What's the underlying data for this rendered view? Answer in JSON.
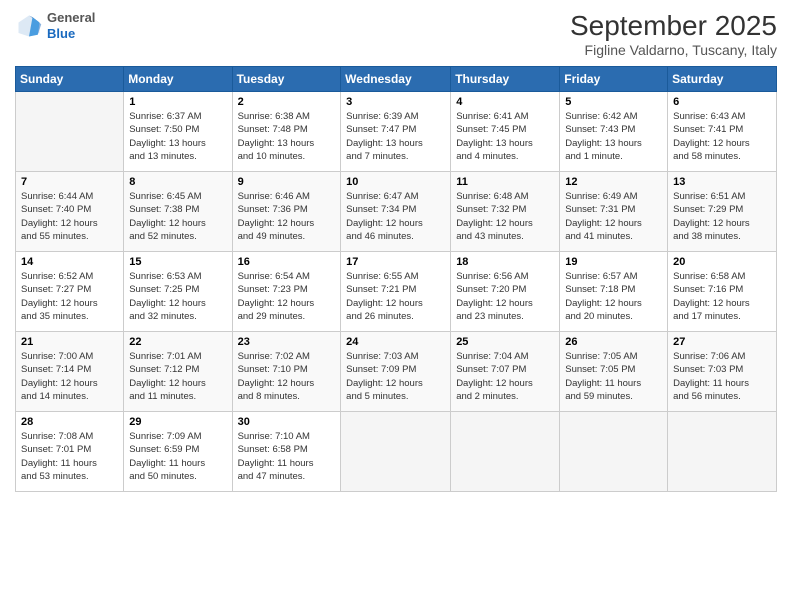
{
  "header": {
    "logo": {
      "general": "General",
      "blue": "Blue"
    },
    "title": "September 2025",
    "subtitle": "Figline Valdarno, Tuscany, Italy"
  },
  "columns": [
    "Sunday",
    "Monday",
    "Tuesday",
    "Wednesday",
    "Thursday",
    "Friday",
    "Saturday"
  ],
  "weeks": [
    [
      {
        "day": "",
        "info": ""
      },
      {
        "day": "1",
        "info": "Sunrise: 6:37 AM\nSunset: 7:50 PM\nDaylight: 13 hours\nand 13 minutes."
      },
      {
        "day": "2",
        "info": "Sunrise: 6:38 AM\nSunset: 7:48 PM\nDaylight: 13 hours\nand 10 minutes."
      },
      {
        "day": "3",
        "info": "Sunrise: 6:39 AM\nSunset: 7:47 PM\nDaylight: 13 hours\nand 7 minutes."
      },
      {
        "day": "4",
        "info": "Sunrise: 6:41 AM\nSunset: 7:45 PM\nDaylight: 13 hours\nand 4 minutes."
      },
      {
        "day": "5",
        "info": "Sunrise: 6:42 AM\nSunset: 7:43 PM\nDaylight: 13 hours\nand 1 minute."
      },
      {
        "day": "6",
        "info": "Sunrise: 6:43 AM\nSunset: 7:41 PM\nDaylight: 12 hours\nand 58 minutes."
      }
    ],
    [
      {
        "day": "7",
        "info": "Sunrise: 6:44 AM\nSunset: 7:40 PM\nDaylight: 12 hours\nand 55 minutes."
      },
      {
        "day": "8",
        "info": "Sunrise: 6:45 AM\nSunset: 7:38 PM\nDaylight: 12 hours\nand 52 minutes."
      },
      {
        "day": "9",
        "info": "Sunrise: 6:46 AM\nSunset: 7:36 PM\nDaylight: 12 hours\nand 49 minutes."
      },
      {
        "day": "10",
        "info": "Sunrise: 6:47 AM\nSunset: 7:34 PM\nDaylight: 12 hours\nand 46 minutes."
      },
      {
        "day": "11",
        "info": "Sunrise: 6:48 AM\nSunset: 7:32 PM\nDaylight: 12 hours\nand 43 minutes."
      },
      {
        "day": "12",
        "info": "Sunrise: 6:49 AM\nSunset: 7:31 PM\nDaylight: 12 hours\nand 41 minutes."
      },
      {
        "day": "13",
        "info": "Sunrise: 6:51 AM\nSunset: 7:29 PM\nDaylight: 12 hours\nand 38 minutes."
      }
    ],
    [
      {
        "day": "14",
        "info": "Sunrise: 6:52 AM\nSunset: 7:27 PM\nDaylight: 12 hours\nand 35 minutes."
      },
      {
        "day": "15",
        "info": "Sunrise: 6:53 AM\nSunset: 7:25 PM\nDaylight: 12 hours\nand 32 minutes."
      },
      {
        "day": "16",
        "info": "Sunrise: 6:54 AM\nSunset: 7:23 PM\nDaylight: 12 hours\nand 29 minutes."
      },
      {
        "day": "17",
        "info": "Sunrise: 6:55 AM\nSunset: 7:21 PM\nDaylight: 12 hours\nand 26 minutes."
      },
      {
        "day": "18",
        "info": "Sunrise: 6:56 AM\nSunset: 7:20 PM\nDaylight: 12 hours\nand 23 minutes."
      },
      {
        "day": "19",
        "info": "Sunrise: 6:57 AM\nSunset: 7:18 PM\nDaylight: 12 hours\nand 20 minutes."
      },
      {
        "day": "20",
        "info": "Sunrise: 6:58 AM\nSunset: 7:16 PM\nDaylight: 12 hours\nand 17 minutes."
      }
    ],
    [
      {
        "day": "21",
        "info": "Sunrise: 7:00 AM\nSunset: 7:14 PM\nDaylight: 12 hours\nand 14 minutes."
      },
      {
        "day": "22",
        "info": "Sunrise: 7:01 AM\nSunset: 7:12 PM\nDaylight: 12 hours\nand 11 minutes."
      },
      {
        "day": "23",
        "info": "Sunrise: 7:02 AM\nSunset: 7:10 PM\nDaylight: 12 hours\nand 8 minutes."
      },
      {
        "day": "24",
        "info": "Sunrise: 7:03 AM\nSunset: 7:09 PM\nDaylight: 12 hours\nand 5 minutes."
      },
      {
        "day": "25",
        "info": "Sunrise: 7:04 AM\nSunset: 7:07 PM\nDaylight: 12 hours\nand 2 minutes."
      },
      {
        "day": "26",
        "info": "Sunrise: 7:05 AM\nSunset: 7:05 PM\nDaylight: 11 hours\nand 59 minutes."
      },
      {
        "day": "27",
        "info": "Sunrise: 7:06 AM\nSunset: 7:03 PM\nDaylight: 11 hours\nand 56 minutes."
      }
    ],
    [
      {
        "day": "28",
        "info": "Sunrise: 7:08 AM\nSunset: 7:01 PM\nDaylight: 11 hours\nand 53 minutes."
      },
      {
        "day": "29",
        "info": "Sunrise: 7:09 AM\nSunset: 6:59 PM\nDaylight: 11 hours\nand 50 minutes."
      },
      {
        "day": "30",
        "info": "Sunrise: 7:10 AM\nSunset: 6:58 PM\nDaylight: 11 hours\nand 47 minutes."
      },
      {
        "day": "",
        "info": ""
      },
      {
        "day": "",
        "info": ""
      },
      {
        "day": "",
        "info": ""
      },
      {
        "day": "",
        "info": ""
      }
    ]
  ]
}
